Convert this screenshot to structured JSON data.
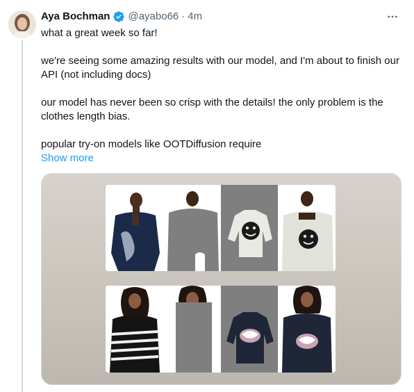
{
  "tweet": {
    "author_name": "Aya Bochman",
    "handle": "@ayabo66",
    "separator": "·",
    "time": "4m",
    "paragraphs": [
      "what a great week so far!",
      "we're seeing some amazing results with our model, and I'm about to finish our API (not including docs)",
      "our model has never been so crisp with the details! the only problem is the clothes length bias.",
      "popular try-on models like OOTDiffusion require"
    ],
    "show_more": "Show more",
    "icons": {
      "verified": "verified-badge-icon",
      "more": "more-options-icon"
    }
  },
  "colors": {
    "link": "#1d9bf0",
    "secondary_text": "#536471",
    "mask_gray": "#7f7f7f"
  }
}
